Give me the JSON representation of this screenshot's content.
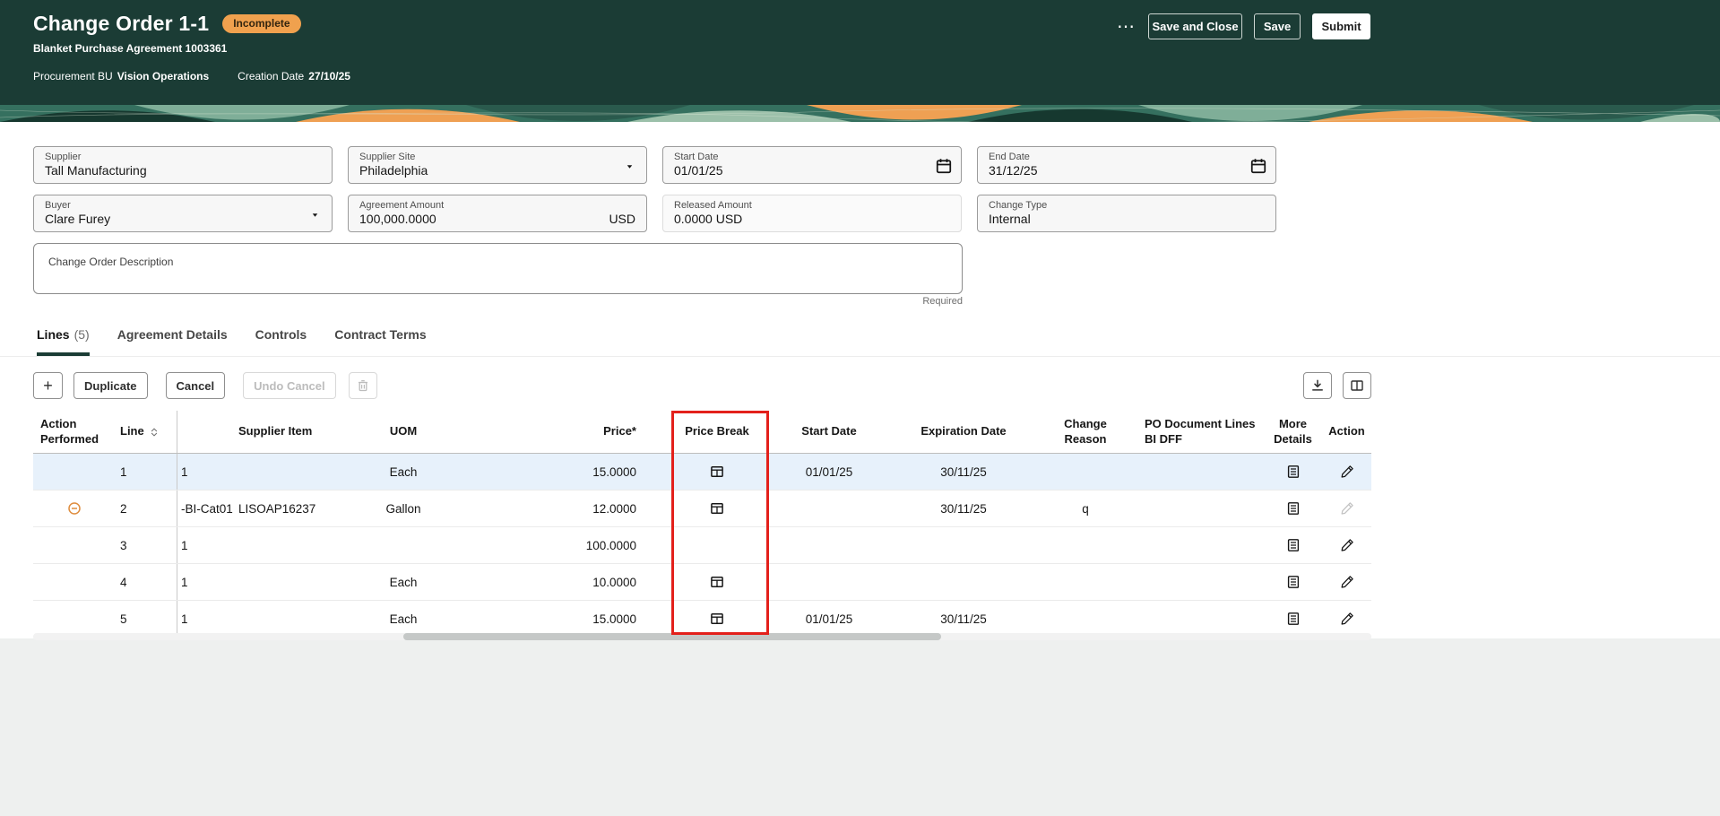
{
  "colors": {
    "header_bg": "#1b3c35",
    "badge_bg": "#f0a14e",
    "selected_row_bg": "#e7f1fb",
    "annotation_red": "#e3201b",
    "banner_teal": "#35705f",
    "banner_orange": "#efa053"
  },
  "header": {
    "title": "Change Order 1-1",
    "badge": "Incomplete",
    "subtitle": "Blanket Purchase Agreement 1003361",
    "procurement_bu_label": "Procurement BU",
    "procurement_bu_value": "Vision Operations",
    "creation_date_label": "Creation Date",
    "creation_date_value": "27/10/25",
    "more_label": "⋯",
    "save_and_close_label": "Save and Close",
    "save_label": "Save",
    "submit_label": "Submit"
  },
  "form": {
    "supplier": {
      "label": "Supplier",
      "value": "Tall Manufacturing"
    },
    "supplier_site": {
      "label": "Supplier Site",
      "value": "Philadelphia"
    },
    "start_date": {
      "label": "Start Date",
      "value": "01/01/25"
    },
    "end_date": {
      "label": "End Date",
      "value": "31/12/25"
    },
    "buyer": {
      "label": "Buyer",
      "value": "Clare Furey"
    },
    "agreement_amount": {
      "label": "Agreement Amount",
      "value": "100,000.0000",
      "currency": "USD"
    },
    "released_amount": {
      "label": "Released Amount",
      "value": "0.0000 USD"
    },
    "change_type": {
      "label": "Change Type",
      "value": "Internal"
    },
    "description": {
      "label": "Change Order Description",
      "value": "",
      "required_hint": "Required"
    }
  },
  "tabs": {
    "lines_label": "Lines",
    "lines_count": "(5)",
    "agreement_details": "Agreement Details",
    "controls": "Controls",
    "contract_terms": "Contract Terms"
  },
  "toolbar": {
    "add_label": "+",
    "duplicate_label": "Duplicate",
    "cancel_label": "Cancel",
    "undo_cancel_label": "Undo Cancel"
  },
  "table": {
    "headers": {
      "action_performed": "Action Performed",
      "line": "Line",
      "supplier_item": "Supplier Item",
      "uom": "UOM",
      "price": "Price*",
      "price_break": "Price Break",
      "start_date": "Start Date",
      "expiration_date": "Expiration Date",
      "change_reason": "Change Reason",
      "po_dff": "PO Document Lines BI DFF",
      "more_details": "More Details",
      "action": "Action"
    },
    "rows": [
      {
        "line": "1",
        "item": "1",
        "supplier_item": "",
        "uom": "Each",
        "price": "15.0000",
        "start_date": "01/01/25",
        "expiration_date": "30/11/25",
        "change_reason": ""
      },
      {
        "line": "2",
        "item": "-BI-Cat01",
        "supplier_item": "LISOAP16237",
        "uom": "Gallon",
        "price": "12.0000",
        "start_date": "",
        "expiration_date": "30/11/25",
        "change_reason": "q"
      },
      {
        "line": "3",
        "item": "1",
        "supplier_item": "",
        "uom": "",
        "price": "100.0000",
        "start_date": "",
        "expiration_date": "",
        "change_reason": ""
      },
      {
        "line": "4",
        "item": "1",
        "supplier_item": "",
        "uom": "Each",
        "price": "10.0000",
        "start_date": "",
        "expiration_date": "",
        "change_reason": ""
      },
      {
        "line": "5",
        "item": "1",
        "supplier_item": "",
        "uom": "Each",
        "price": "15.0000",
        "start_date": "01/01/25",
        "expiration_date": "30/11/25",
        "change_reason": ""
      }
    ]
  }
}
